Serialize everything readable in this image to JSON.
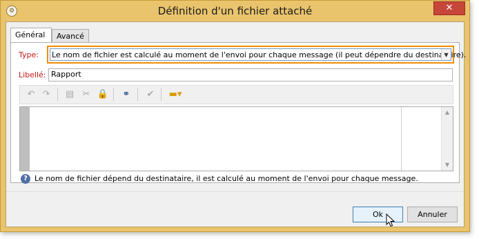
{
  "window": {
    "title": "Définition d'un fichier attaché",
    "close_glyph": "✕"
  },
  "tabs": [
    {
      "label": "Général",
      "active": true
    },
    {
      "label": "Avancé",
      "active": false
    }
  ],
  "form": {
    "type_label": "Type:",
    "type_value": "Le nom de fichier est calculé au moment de l'envoi pour chaque message (il peut dépendre du destinataire).",
    "libelle_label": "Libellé:",
    "libelle_value": "Rapport"
  },
  "toolbar": {
    "icons": [
      "undo-icon",
      "redo-icon",
      "paste-icon",
      "cut-icon",
      "clipboard-lock-icon",
      "binoculars-icon",
      "check-icon",
      "insert-field-icon"
    ]
  },
  "help": {
    "text": "Le nom de fichier dépend du destinataire, il est calculé au moment de l'envoi pour chaque message."
  },
  "buttons": {
    "ok_label": "Ok",
    "cancel_label": "Annuler"
  },
  "colors": {
    "title_bar": "#e9c46d",
    "highlight": "#f08c00",
    "label_red": "#c21515",
    "close": "#c7463a"
  }
}
